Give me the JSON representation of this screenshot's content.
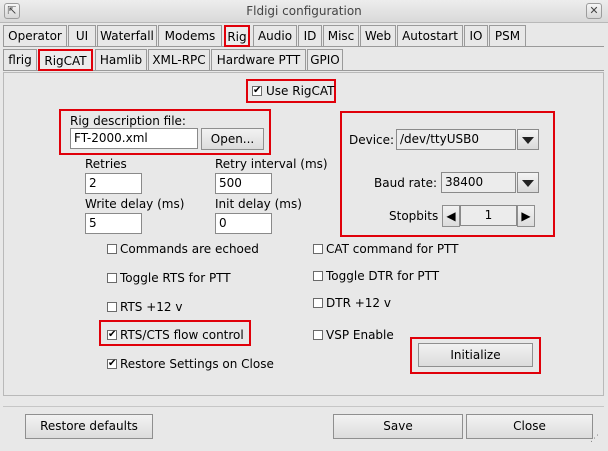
{
  "window": {
    "title": "Fldigi configuration",
    "close_glyph": "✕",
    "restore_glyph": "⇱"
  },
  "tabs_row1": [
    "Operator",
    "UI",
    "Waterfall",
    "Modems",
    "Rig",
    "Audio",
    "ID",
    "Misc",
    "Web",
    "Autostart",
    "IO",
    "PSM"
  ],
  "tabs_row2": [
    "flrig",
    "RigCAT",
    "Hamlib",
    "XML-RPC",
    "Hardware PTT",
    "GPIO"
  ],
  "use_rigcat": {
    "label": "Use RigCAT",
    "checked": true
  },
  "rig_description": {
    "label": "Rig description file:",
    "value": "FT-2000.xml",
    "open_label": "Open..."
  },
  "device": {
    "label": "Device:",
    "value": "/dev/ttyUSB0"
  },
  "baud": {
    "label": "Baud rate:",
    "value": "38400"
  },
  "stopbits": {
    "label": "Stopbits",
    "value": "1"
  },
  "retries": {
    "label": "Retries",
    "value": "2"
  },
  "retry_interval": {
    "label": "Retry interval (ms)",
    "value": "500"
  },
  "write_delay": {
    "label": "Write delay (ms)",
    "value": "5"
  },
  "init_delay": {
    "label": "Init delay (ms)",
    "value": "0"
  },
  "options": {
    "commands_echoed": {
      "label": "Commands are echoed",
      "checked": false
    },
    "cat_ptt": {
      "label": "CAT command for PTT",
      "checked": false
    },
    "toggle_rts": {
      "label": "Toggle RTS for PTT",
      "checked": false
    },
    "toggle_dtr": {
      "label": "Toggle DTR for PTT",
      "checked": false
    },
    "rts_12v": {
      "label": "RTS +12 v",
      "checked": false
    },
    "dtr_12v": {
      "label": "DTR +12 v",
      "checked": false
    },
    "rts_cts": {
      "label": "RTS/CTS flow control",
      "checked": true
    },
    "vsp": {
      "label": "VSP Enable",
      "checked": false
    },
    "restore_on_close": {
      "label": "Restore Settings on Close",
      "checked": true
    }
  },
  "initialize_label": "Initialize",
  "footer": {
    "restore_defaults": "Restore defaults",
    "save": "Save",
    "close": "Close"
  },
  "highlight_color": "#e0000a"
}
